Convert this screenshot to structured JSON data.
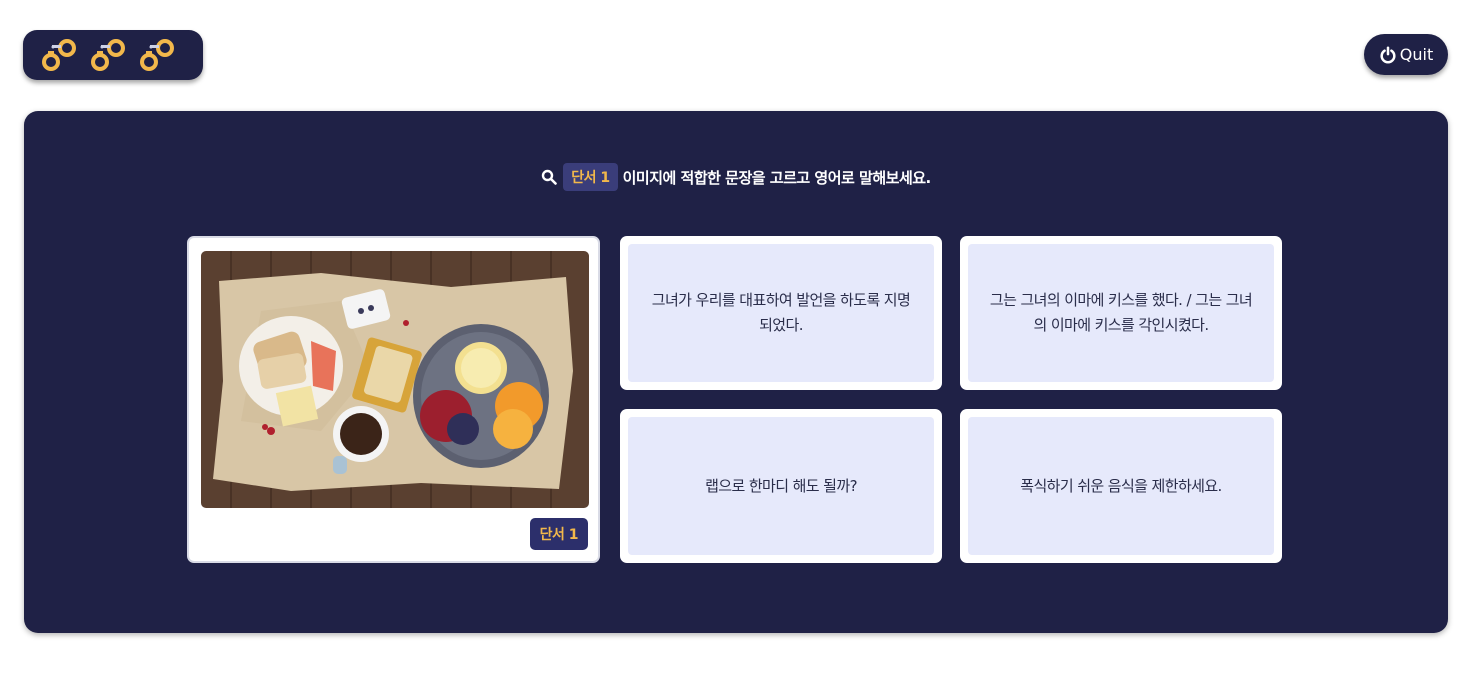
{
  "lives": {
    "count": 3,
    "icon": "handcuffs-icon",
    "color": "#f2b84b"
  },
  "quit": {
    "label": "Quit",
    "icon": "power-icon"
  },
  "instruction": {
    "icon": "search-icon",
    "badge": "단서 1",
    "text": "이미지에 적합한 문장을 고르고 영어로 말해보세요."
  },
  "clue_card": {
    "image": "breakfast-table-photo",
    "badge": "단서 1"
  },
  "options": [
    {
      "text": "그녀가 우리를 대표하여 발언을 하도록 지명되었다."
    },
    {
      "text": "그는 그녀의 이마에 키스를 했다. / 그는 그녀의 이마에 키스를 각인시켰다."
    },
    {
      "text": "랩으로 한마디 해도 될까?"
    },
    {
      "text": "폭식하기 쉬운 음식을 제한하세요."
    }
  ],
  "colors": {
    "panel": "#1f2146",
    "accent": "#f2b84b",
    "option_bg": "#e6e9fb"
  }
}
